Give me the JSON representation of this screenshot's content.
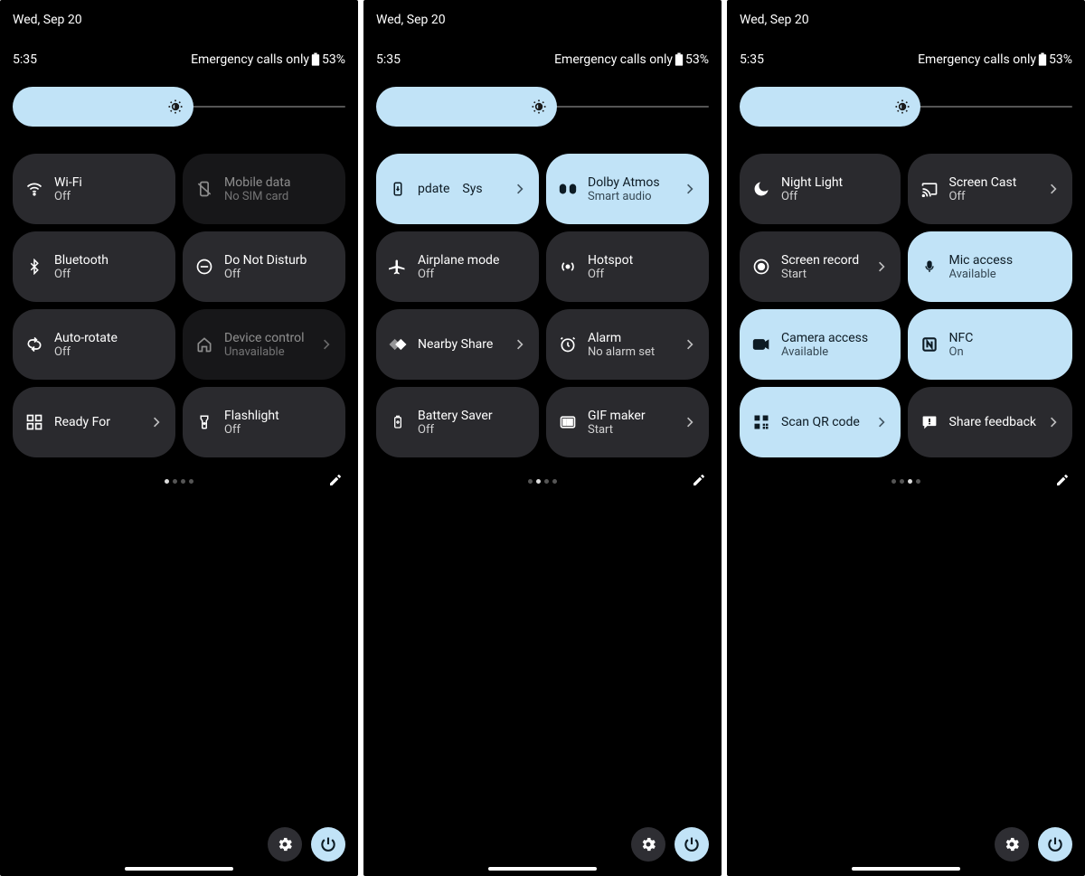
{
  "header": {
    "date": "Wed, Sep 20",
    "time": "5:35",
    "network_status": "Emergency calls only",
    "battery": "53%"
  },
  "panels": [
    {
      "pager_active": 0,
      "tiles": [
        {
          "title": "Wi-Fi",
          "sub": "Off",
          "name": "tile-wifi",
          "icon": "wifi",
          "chevron": false,
          "active": false,
          "disabled": false
        },
        {
          "title": "Mobile data",
          "sub": "No SIM card",
          "name": "tile-mobile-data",
          "icon": "mobiledata",
          "chevron": false,
          "active": false,
          "disabled": true
        },
        {
          "title": "Bluetooth",
          "sub": "Off",
          "name": "tile-bluetooth",
          "icon": "bluetooth",
          "chevron": false,
          "active": false,
          "disabled": false
        },
        {
          "title": "Do Not Disturb",
          "sub": "Off",
          "name": "tile-dnd",
          "icon": "dnd",
          "chevron": false,
          "active": false,
          "disabled": false
        },
        {
          "title": "Auto-rotate",
          "sub": "Off",
          "name": "tile-auto-rotate",
          "icon": "rotate",
          "chevron": false,
          "active": false,
          "disabled": false
        },
        {
          "title": "Device control",
          "sub": "Unavailable",
          "name": "tile-device-control",
          "icon": "home",
          "chevron": true,
          "active": false,
          "disabled": true
        },
        {
          "title": "Ready For",
          "sub": "",
          "name": "tile-ready-for",
          "icon": "readyfor",
          "chevron": true,
          "active": false,
          "disabled": false
        },
        {
          "title": "Flashlight",
          "sub": "Off",
          "name": "tile-flashlight",
          "icon": "flashlight",
          "chevron": false,
          "active": false,
          "disabled": false
        }
      ]
    },
    {
      "pager_active": 1,
      "tiles": [
        {
          "title": "pdate",
          "sub": "Sys",
          "name": "tile-system-update",
          "icon": "update",
          "chevron": true,
          "active": true,
          "disabled": false,
          "scrolling": true
        },
        {
          "title": "Dolby Atmos",
          "sub": "Smart audio",
          "name": "tile-dolby-atmos",
          "icon": "dolby",
          "chevron": true,
          "active": true,
          "disabled": false
        },
        {
          "title": "Airplane mode",
          "sub": "Off",
          "name": "tile-airplane",
          "icon": "airplane",
          "chevron": false,
          "active": false,
          "disabled": false
        },
        {
          "title": "Hotspot",
          "sub": "Off",
          "name": "tile-hotspot",
          "icon": "hotspot",
          "chevron": false,
          "active": false,
          "disabled": false
        },
        {
          "title": "Nearby Share",
          "sub": "",
          "name": "tile-nearby-share",
          "icon": "nearby",
          "chevron": true,
          "active": false,
          "disabled": false
        },
        {
          "title": "Alarm",
          "sub": "No alarm set",
          "name": "tile-alarm",
          "icon": "alarm",
          "chevron": true,
          "active": false,
          "disabled": false
        },
        {
          "title": "Battery Saver",
          "sub": "Off",
          "name": "tile-battery-saver",
          "icon": "battsaver",
          "chevron": false,
          "active": false,
          "disabled": false
        },
        {
          "title": "GIF maker",
          "sub": "Start",
          "name": "tile-gif-maker",
          "icon": "gif",
          "chevron": true,
          "active": false,
          "disabled": false
        }
      ]
    },
    {
      "pager_active": 2,
      "tiles": [
        {
          "title": "Night Light",
          "sub": "Off",
          "name": "tile-night-light",
          "icon": "moon",
          "chevron": false,
          "active": false,
          "disabled": false
        },
        {
          "title": "Screen Cast",
          "sub": "Off",
          "name": "tile-screen-cast",
          "icon": "cast",
          "chevron": true,
          "active": false,
          "disabled": false
        },
        {
          "title": "Screen record",
          "sub": "Start",
          "name": "tile-screen-record",
          "icon": "record",
          "chevron": true,
          "active": false,
          "disabled": false
        },
        {
          "title": "Mic access",
          "sub": "Available",
          "name": "tile-mic-access",
          "icon": "mic",
          "chevron": false,
          "active": true,
          "disabled": false
        },
        {
          "title": "Camera access",
          "sub": "Available",
          "name": "tile-camera-access",
          "icon": "camera",
          "chevron": false,
          "active": true,
          "disabled": false
        },
        {
          "title": "NFC",
          "sub": "On",
          "name": "tile-nfc",
          "icon": "nfc",
          "chevron": false,
          "active": true,
          "disabled": false
        },
        {
          "title": "Scan QR code",
          "sub": "",
          "name": "tile-qr",
          "icon": "qr",
          "chevron": true,
          "active": true,
          "disabled": false
        },
        {
          "title": "Share feedback",
          "sub": "",
          "name": "tile-feedback",
          "icon": "feedback",
          "chevron": true,
          "active": false,
          "disabled": false
        }
      ]
    }
  ]
}
